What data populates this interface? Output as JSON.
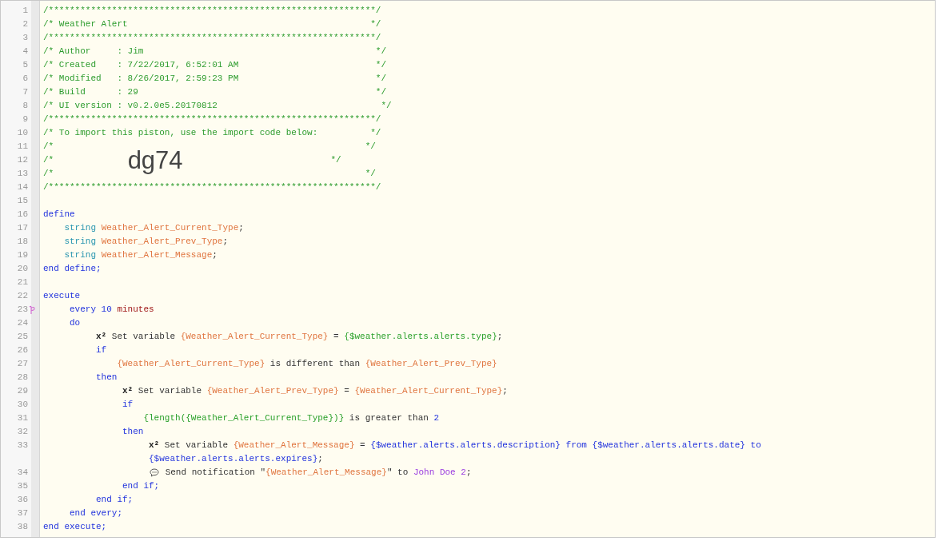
{
  "lines": [
    {
      "number": "1",
      "flagged": false,
      "tokens": [
        {
          "kind": "comment",
          "text": "/**************************************************************/"
        }
      ]
    },
    {
      "number": "2",
      "flagged": false,
      "tokens": [
        {
          "kind": "comment",
          "text": "/* Weather Alert                                              */"
        }
      ]
    },
    {
      "number": "3",
      "flagged": false,
      "tokens": [
        {
          "kind": "comment",
          "text": "/**************************************************************/"
        }
      ]
    },
    {
      "number": "4",
      "flagged": false,
      "tokens": [
        {
          "kind": "comment",
          "text": "/* Author     : Jim                                            */"
        }
      ]
    },
    {
      "number": "5",
      "flagged": false,
      "tokens": [
        {
          "kind": "comment",
          "text": "/* Created    : 7/22/2017, 6:52:01 AM                          */"
        }
      ]
    },
    {
      "number": "6",
      "flagged": false,
      "tokens": [
        {
          "kind": "comment",
          "text": "/* Modified   : 8/26/2017, 2:59:23 PM                          */"
        }
      ]
    },
    {
      "number": "7",
      "flagged": false,
      "tokens": [
        {
          "kind": "comment",
          "text": "/* Build      : 29                                             */"
        }
      ]
    },
    {
      "number": "8",
      "flagged": false,
      "tokens": [
        {
          "kind": "comment",
          "text": "/* UI version : v0.2.0e5.20170812                               */"
        }
      ]
    },
    {
      "number": "9",
      "flagged": false,
      "tokens": [
        {
          "kind": "comment",
          "text": "/**************************************************************/"
        }
      ]
    },
    {
      "number": "10",
      "flagged": false,
      "tokens": [
        {
          "kind": "comment",
          "text": "/* To import this piston, use the import code below:          */"
        }
      ]
    },
    {
      "number": "11",
      "flagged": false,
      "tokens": [
        {
          "kind": "comment",
          "text": "/*                                                           */"
        }
      ]
    },
    {
      "number": "12",
      "flagged": false,
      "tokens": [
        {
          "kind": "comment",
          "text": "/*              "
        },
        {
          "kind": "import_code",
          "text": "dg74"
        },
        {
          "kind": "comment",
          "text": "                            */"
        }
      ]
    },
    {
      "number": "13",
      "flagged": false,
      "tokens": [
        {
          "kind": "comment",
          "text": "/*                                                           */"
        }
      ]
    },
    {
      "number": "14",
      "flagged": false,
      "tokens": [
        {
          "kind": "comment",
          "text": "/**************************************************************/"
        }
      ]
    },
    {
      "number": "15",
      "flagged": false
    },
    {
      "number": "16",
      "flagged": false,
      "tokens": [
        {
          "kind": "keyword",
          "text": "define"
        }
      ]
    },
    {
      "number": "17",
      "flagged": false,
      "tokens": [
        {
          "kind": "type",
          "text": "    string "
        },
        {
          "kind": "variable",
          "text": "Weather_Alert_Current_Type"
        },
        {
          "kind": "plain",
          "text": ";"
        }
      ]
    },
    {
      "number": "18",
      "flagged": false,
      "tokens": [
        {
          "kind": "type",
          "text": "    string "
        },
        {
          "kind": "variable",
          "text": "Weather_Alert_Prev_Type"
        },
        {
          "kind": "plain",
          "text": ";"
        }
      ]
    },
    {
      "number": "19",
      "flagged": false,
      "tokens": [
        {
          "kind": "type",
          "text": "    string "
        },
        {
          "kind": "variable",
          "text": "Weather_Alert_Message"
        },
        {
          "kind": "plain",
          "text": ";"
        }
      ]
    },
    {
      "number": "20",
      "flagged": false,
      "tokens": [
        {
          "kind": "keyword",
          "text": "end define;"
        }
      ]
    },
    {
      "number": "21",
      "flagged": false
    },
    {
      "number": "22",
      "flagged": false,
      "tokens": [
        {
          "kind": "keyword",
          "text": "execute"
        }
      ]
    },
    {
      "number": "23",
      "flagged": true,
      "tokens": [
        {
          "kind": "keyword",
          "text": "     every 10 "
        },
        {
          "kind": "unit",
          "text": "minutes"
        }
      ]
    },
    {
      "number": "24",
      "flagged": false,
      "tokens": [
        {
          "kind": "keyword",
          "text": "     do"
        }
      ]
    },
    {
      "number": "25",
      "flagged": false,
      "tokens": [
        {
          "kind": "op",
          "text": "          x²"
        },
        {
          "kind": "plain",
          "text": " Set variable "
        },
        {
          "kind": "variable",
          "text": "{Weather_Alert_Current_Type}"
        },
        {
          "kind": "plain",
          "text": " = "
        },
        {
          "kind": "expr",
          "text": "{$weather.alerts.alerts.type}"
        },
        {
          "kind": "plain",
          "text": ";"
        }
      ]
    },
    {
      "number": "26",
      "flagged": false,
      "tokens": [
        {
          "kind": "keyword",
          "text": "          if"
        }
      ]
    },
    {
      "number": "27",
      "flagged": false,
      "tokens": [
        {
          "kind": "variable",
          "text": "              {Weather_Alert_Current_Type}"
        },
        {
          "kind": "plain",
          "text": " is different than "
        },
        {
          "kind": "variable",
          "text": "{Weather_Alert_Prev_Type}"
        }
      ]
    },
    {
      "number": "28",
      "flagged": false,
      "tokens": [
        {
          "kind": "keyword",
          "text": "          then"
        }
      ]
    },
    {
      "number": "29",
      "flagged": false,
      "tokens": [
        {
          "kind": "op",
          "text": "               x²"
        },
        {
          "kind": "plain",
          "text": " Set variable "
        },
        {
          "kind": "variable",
          "text": "{Weather_Alert_Prev_Type}"
        },
        {
          "kind": "plain",
          "text": " = "
        },
        {
          "kind": "variable",
          "text": "{Weather_Alert_Current_Type}"
        },
        {
          "kind": "plain",
          "text": ";"
        }
      ]
    },
    {
      "number": "30",
      "flagged": false,
      "tokens": [
        {
          "kind": "keyword",
          "text": "               if"
        }
      ]
    },
    {
      "number": "31",
      "flagged": false,
      "tokens": [
        {
          "kind": "expr",
          "text": "                   {length({Weather_Alert_Current_Type})}"
        },
        {
          "kind": "plain",
          "text": " is greater than "
        },
        {
          "kind": "keyword",
          "text": "2"
        }
      ]
    },
    {
      "number": "32",
      "flagged": false,
      "tokens": [
        {
          "kind": "keyword",
          "text": "               then"
        }
      ]
    },
    {
      "number": "33",
      "flagged": false,
      "tokens": [
        {
          "kind": "op",
          "text": "                    x²"
        },
        {
          "kind": "plain",
          "text": " Set variable "
        },
        {
          "kind": "variable",
          "text": "{Weather_Alert_Message}"
        },
        {
          "kind": "plain",
          "text": " = "
        },
        {
          "kind": "keyword",
          "text": "{$weather.alerts.alerts.description} from {$weather.alerts.alerts.date} to"
        }
      ],
      "wrap": [
        {
          "kind": "keyword",
          "text": "                    {$weather.alerts.alerts.expires}"
        },
        {
          "kind": "plain",
          "text": ";"
        }
      ]
    },
    {
      "number": "34",
      "flagged": false,
      "tokens": [
        {
          "kind": "notify_icon"
        },
        {
          "kind": "plain",
          "text": " Send notification \""
        },
        {
          "kind": "variable",
          "text": "{Weather_Alert_Message}"
        },
        {
          "kind": "plain",
          "text": "\" to "
        },
        {
          "kind": "device",
          "text": "John Doe 2"
        },
        {
          "kind": "plain",
          "text": ";"
        }
      ]
    },
    {
      "number": "35",
      "flagged": false,
      "tokens": [
        {
          "kind": "keyword",
          "text": "               end if;"
        }
      ]
    },
    {
      "number": "36",
      "flagged": false,
      "tokens": [
        {
          "kind": "keyword",
          "text": "          end if;"
        }
      ]
    },
    {
      "number": "37",
      "flagged": false,
      "tokens": [
        {
          "kind": "keyword",
          "text": "     end every;"
        }
      ]
    },
    {
      "number": "38",
      "flagged": false,
      "tokens": [
        {
          "kind": "keyword",
          "text": "end execute;"
        }
      ]
    }
  ]
}
